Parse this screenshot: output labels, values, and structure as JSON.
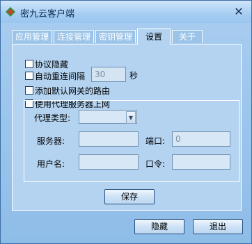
{
  "window": {
    "title": "密九云客户端"
  },
  "tabs": [
    {
      "label": "应用管理"
    },
    {
      "label": "连接管理"
    },
    {
      "label": "密钥管理"
    },
    {
      "label": "设置"
    },
    {
      "label": "关于"
    }
  ],
  "settings": {
    "hide_protocol": {
      "label": "协议隐藏",
      "checked": false
    },
    "auto_reconnect": {
      "label": "自动重连间隔",
      "checked": false,
      "value": "30",
      "unit": "秒"
    },
    "add_default_route": {
      "label": "添加默认网关的路由",
      "checked": false
    },
    "use_proxy": {
      "label": "使用代理服务器上网",
      "checked": false
    }
  },
  "proxy": {
    "type_label": "代理类型:",
    "type_value": "",
    "server_label": "服务器:",
    "server_value": "",
    "port_label": "端口:",
    "port_value": "0",
    "username_label": "用户名:",
    "username_value": "",
    "password_label": "口令:",
    "password_value": "",
    "save_label": "保存"
  },
  "footer": {
    "hide_label": "隐藏",
    "exit_label": "退出"
  },
  "icons": {
    "close": "close-icon",
    "app": "app-icon",
    "dropdown": "chevron-down-icon"
  },
  "colors": {
    "window_bg": "#a9cdf0",
    "panel_bg": "#b3d3f1",
    "border": "#3b6ea5"
  }
}
